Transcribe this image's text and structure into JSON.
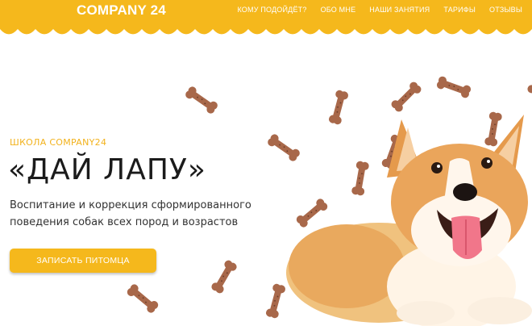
{
  "colors": {
    "brand_yellow": "#f5b81c",
    "eyebrow": "#f2b21c",
    "title": "#1b1b1b",
    "bone": "#a8684a"
  },
  "header": {
    "logo": "COMPANY 24",
    "nav": [
      {
        "label": "КОМУ ПОДОЙДЁТ?"
      },
      {
        "label": "ОБО МНЕ"
      },
      {
        "label": "НАШИ ЗАНЯТИЯ"
      },
      {
        "label": "ТАРИФЫ"
      },
      {
        "label": "ОТЗЫВЫ"
      }
    ]
  },
  "hero": {
    "eyebrow": "ШКОЛА COMPANY24",
    "title": "«ДАЙ ЛАПУ»",
    "subtitle_line1": "Воспитание и коррекция сформированного",
    "subtitle_line2": "поведения собак всех пород и возрастов",
    "cta_label": "ЗАПИСАТЬ ПИТОМЦА"
  },
  "icons": {
    "bone": "dog-treat-bone-icon",
    "dog": "corgi-dog-illustration"
  }
}
